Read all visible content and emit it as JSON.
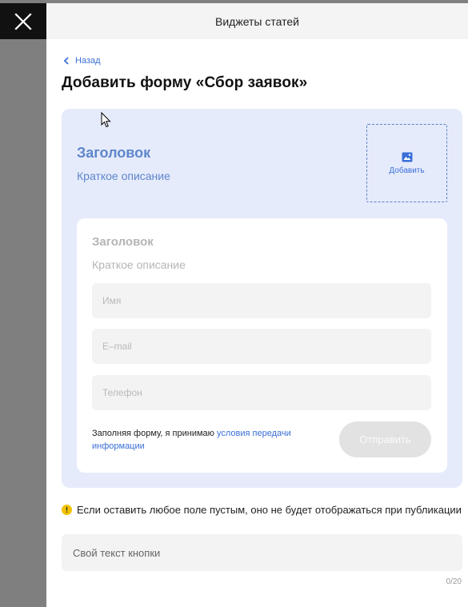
{
  "panel": {
    "header_title": "Виджеты статей",
    "back_label": "Назад",
    "page_title": "Добавить форму «Сбор заявок»"
  },
  "preview": {
    "title": "Заголовок",
    "subtitle": "Краткое описание",
    "add_image_label": "Добавить",
    "inner": {
      "title": "Заголовок",
      "subtitle": "Краткое описание",
      "fields": [
        "Имя",
        "E–mail",
        "Телефон"
      ],
      "consent_text": "Заполняя форму, я принимаю ",
      "consent_link": "условия передачи информации",
      "submit_label": "Отправить"
    }
  },
  "info_text": "Если оставить любое поле пустым, оно не будет отображаться при публикации",
  "button_text_input": {
    "placeholder": "Свой текст кнопки",
    "counter": "0/20"
  },
  "colors": {
    "accent": "#3a6fd8",
    "preview_bg": "#e6ebfb",
    "info_icon": "#f2c200"
  },
  "icons": {
    "close": "close-icon",
    "back": "chevron-left-icon",
    "image": "image-icon",
    "info": "info-icon",
    "cursor": "mouse-pointer-icon"
  }
}
